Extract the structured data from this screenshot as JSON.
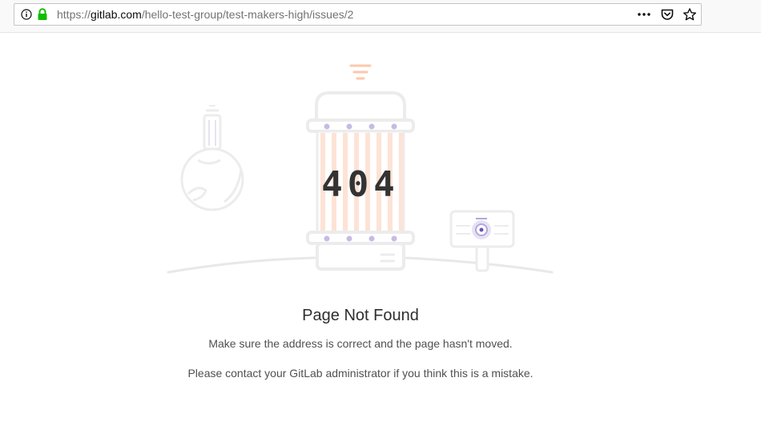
{
  "browser": {
    "url_scheme": "https://",
    "url_host": "gitlab.com",
    "url_path": "/hello-test-group/test-makers-high/issues/2",
    "icons": {
      "info": "info-icon",
      "lock": "lock-icon",
      "more": "more-actions-icon",
      "pocket": "pocket-icon",
      "bookmark": "bookmark-star-icon"
    },
    "lock_color": "#12bc00"
  },
  "page": {
    "error_code": "404",
    "title": "Page Not Found",
    "message_1": "Make sure the address is correct and the page hasn't moved.",
    "message_2": "Please contact your GitLab administrator if you think this is a mistake."
  },
  "colors": {
    "accent_orange": "#fc9867",
    "accent_purple": "#6b4fbb",
    "light_gray": "#eeeeee"
  }
}
